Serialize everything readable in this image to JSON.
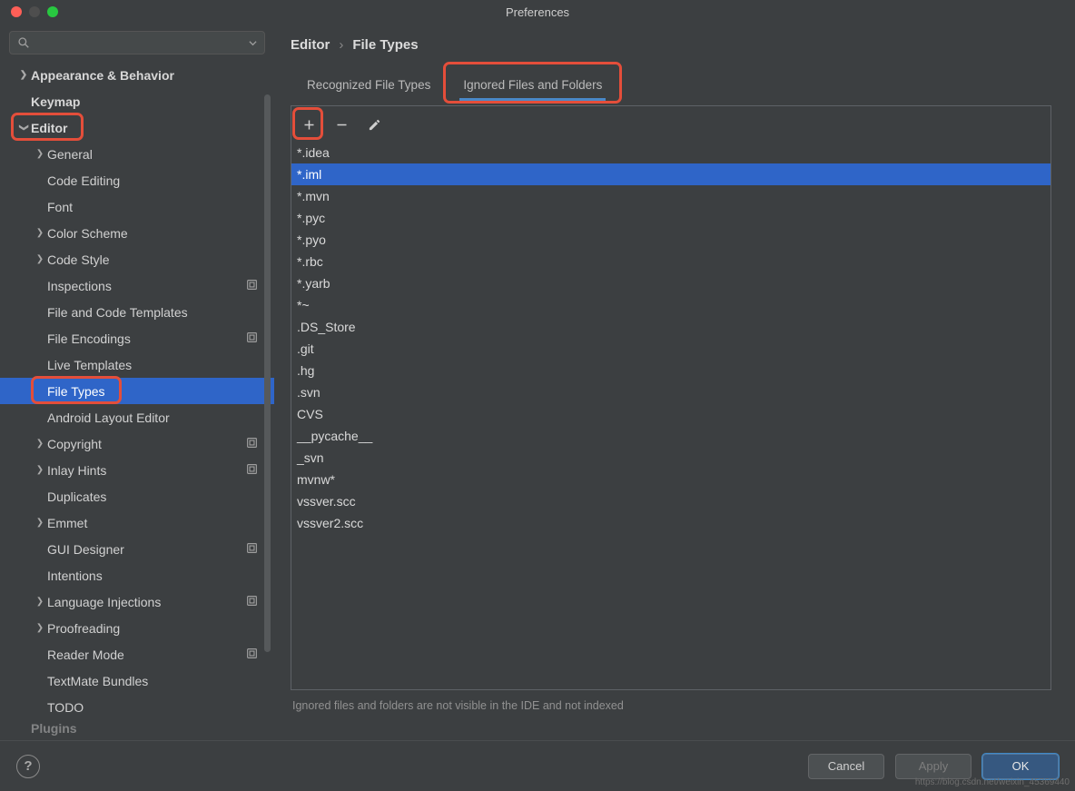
{
  "window": {
    "title": "Preferences"
  },
  "search": {
    "placeholder": ""
  },
  "sidebar": [
    {
      "label": "Appearance & Behavior",
      "level": 0,
      "expand": "closed"
    },
    {
      "label": "Keymap",
      "level": 0,
      "expand": "none"
    },
    {
      "label": "Editor",
      "level": 0,
      "expand": "open",
      "highlight": true
    },
    {
      "label": "General",
      "level": 1,
      "expand": "closed"
    },
    {
      "label": "Code Editing",
      "level": 1,
      "expand": "none"
    },
    {
      "label": "Font",
      "level": 1,
      "expand": "none"
    },
    {
      "label": "Color Scheme",
      "level": 1,
      "expand": "closed"
    },
    {
      "label": "Code Style",
      "level": 1,
      "expand": "closed"
    },
    {
      "label": "Inspections",
      "level": 1,
      "expand": "none",
      "badge": true
    },
    {
      "label": "File and Code Templates",
      "level": 1,
      "expand": "none"
    },
    {
      "label": "File Encodings",
      "level": 1,
      "expand": "none",
      "badge": true
    },
    {
      "label": "Live Templates",
      "level": 1,
      "expand": "none"
    },
    {
      "label": "File Types",
      "level": 1,
      "expand": "none",
      "selected": true,
      "highlight": true
    },
    {
      "label": "Android Layout Editor",
      "level": 1,
      "expand": "none"
    },
    {
      "label": "Copyright",
      "level": 1,
      "expand": "closed",
      "badge": true
    },
    {
      "label": "Inlay Hints",
      "level": 1,
      "expand": "closed",
      "badge": true
    },
    {
      "label": "Duplicates",
      "level": 1,
      "expand": "none"
    },
    {
      "label": "Emmet",
      "level": 1,
      "expand": "closed"
    },
    {
      "label": "GUI Designer",
      "level": 1,
      "expand": "none",
      "badge": true
    },
    {
      "label": "Intentions",
      "level": 1,
      "expand": "none"
    },
    {
      "label": "Language Injections",
      "level": 1,
      "expand": "closed",
      "badge": true
    },
    {
      "label": "Proofreading",
      "level": 1,
      "expand": "closed"
    },
    {
      "label": "Reader Mode",
      "level": 1,
      "expand": "none",
      "badge": true
    },
    {
      "label": "TextMate Bundles",
      "level": 1,
      "expand": "none"
    },
    {
      "label": "TODO",
      "level": 1,
      "expand": "none"
    },
    {
      "label": "Plugins",
      "level": 0,
      "expand": "none",
      "cut": true
    }
  ],
  "breadcrumb": {
    "root": "Editor",
    "leaf": "File Types",
    "sep": "›"
  },
  "tabs": [
    {
      "label": "Recognized File Types",
      "active": false
    },
    {
      "label": "Ignored Files and Folders",
      "active": true,
      "highlight": true
    }
  ],
  "list": [
    {
      "v": "*.idea"
    },
    {
      "v": "*.iml",
      "selected": true
    },
    {
      "v": "*.mvn"
    },
    {
      "v": "*.pyc"
    },
    {
      "v": "*.pyo"
    },
    {
      "v": "*.rbc"
    },
    {
      "v": "*.yarb"
    },
    {
      "v": "*~"
    },
    {
      "v": ".DS_Store"
    },
    {
      "v": ".git"
    },
    {
      "v": ".hg"
    },
    {
      "v": ".svn"
    },
    {
      "v": "CVS"
    },
    {
      "v": "__pycache__"
    },
    {
      "v": "_svn"
    },
    {
      "v": "mvnw*"
    },
    {
      "v": "vssver.scc"
    },
    {
      "v": "vssver2.scc"
    }
  ],
  "hint": "Ignored files and folders are not visible in the IDE and not indexed",
  "buttons": {
    "cancel": "Cancel",
    "apply": "Apply",
    "ok": "OK"
  },
  "watermark": "https://blog.csdn.net/weixin_45369440"
}
